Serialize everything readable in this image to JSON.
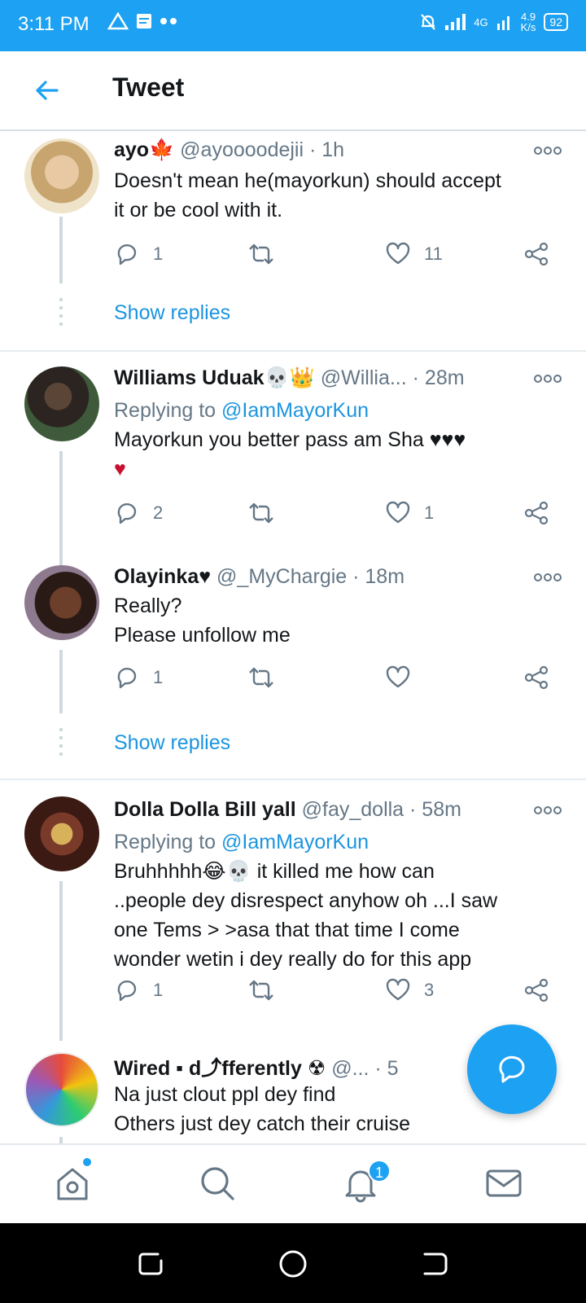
{
  "status_bar": {
    "time": "3:11 PM",
    "network_type": "4G",
    "speed_value": "4.9",
    "speed_unit": "K/s",
    "battery": "92"
  },
  "header": {
    "title": "Tweet",
    "back_icon": "arrow-left-icon"
  },
  "colors": {
    "accent": "#1da1f2",
    "link": "#1b95e0",
    "secondary_text": "#657786",
    "heart": "#e0245e"
  },
  "tweets": [
    {
      "name": "ayo🍁",
      "handle": "@ayoooodejii · 1h",
      "replying_to": "",
      "text_lines": [
        "Doesn't mean he(mayorkun) should accept",
        "it or be cool with it."
      ],
      "replies": "1",
      "retweets": "",
      "likes": "11",
      "show_replies": "Show replies"
    },
    {
      "name": "Williams Uduak💀👑",
      "handle": "@Willia... · 28m",
      "replying_label": "Replying to",
      "replying_to": "@IamMayorKun",
      "text_lines": [
        "Mayorkun you better pass am Sha ♥♥♥",
        "♥"
      ],
      "replies": "2",
      "retweets": "",
      "likes": "1"
    },
    {
      "name": "Olayinka♥",
      "handle": "@_MyChargie · 18m",
      "replying_to": "",
      "text_lines": [
        "Really?",
        "Please unfollow me"
      ],
      "replies": "1",
      "retweets": "",
      "likes": "",
      "show_replies": "Show replies"
    },
    {
      "name": "Dolla Dolla Bill yall",
      "handle": "@fay_dolla · 58m",
      "replying_label": "Replying to",
      "replying_to": "@IamMayorKun",
      "text_lines": [
        "Bruhhhhh😂💀 it killed me how can",
        "..people dey disrespect anyhow oh ...I saw",
        "one Tems > >asa  that that time I come",
        "wonder wetin i dey really do for this app"
      ],
      "replies": "1",
      "retweets": "",
      "likes": "3"
    },
    {
      "name": "Wired ▪ d⤴fferently ☢",
      "handle": "@... · 5",
      "replying_to": "",
      "text_lines": [
        "Na just clout ppl dey find",
        "Others just dey catch their cruise"
      ]
    }
  ],
  "bottom_nav": {
    "items": [
      "home-icon",
      "search-icon",
      "notifications-icon",
      "messages-icon"
    ],
    "notification_count": "1"
  },
  "fab": {
    "icon": "reply-bubble-icon"
  }
}
